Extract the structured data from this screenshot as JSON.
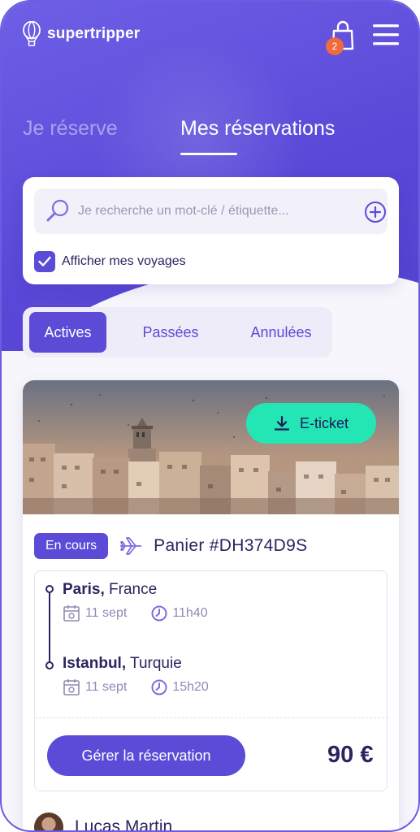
{
  "header": {
    "logo_text": "supertripper",
    "cart_count": "2"
  },
  "main_tabs": {
    "book": "Je réserve",
    "my_bookings": "Mes réservations"
  },
  "search": {
    "placeholder": "Je recherche un mot-clé / étiquette..."
  },
  "filter": {
    "show_trips_label": "Afficher mes voyages",
    "show_trips_checked": true
  },
  "segments": {
    "active": "Actives",
    "past": "Passées",
    "cancelled": "Annulées"
  },
  "reservation": {
    "eticket_label": "E-ticket",
    "status": "En cours",
    "cart_label": "Panier #DH374D9S",
    "departure": {
      "city": "Paris,",
      "country": " France",
      "date": "11 sept",
      "time": "11h40"
    },
    "arrival": {
      "city": "Istanbul,",
      "country": " Turquie",
      "date": "11 sept",
      "time": "15h20"
    },
    "manage_label": "Gérer la réservation",
    "price": "90 €",
    "traveler_name": "Lucas Martin"
  },
  "colors": {
    "primary": "#5b4bd6",
    "accent": "#23e6b4",
    "badge": "#f06a3d",
    "text": "#2a2560"
  }
}
